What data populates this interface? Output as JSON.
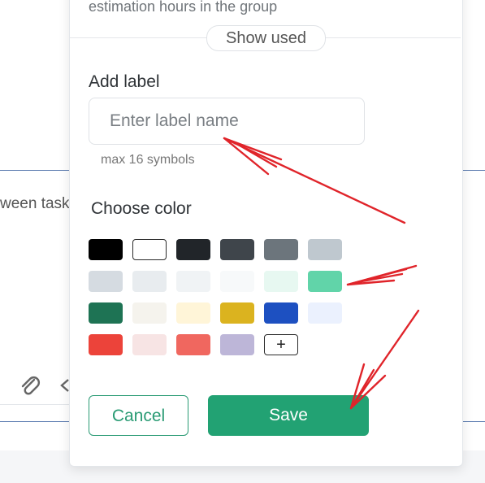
{
  "background": {
    "partial_text": "ween task"
  },
  "modal": {
    "top_hint": "estimation hours in the group",
    "show_used_label": "Show used",
    "add_label": {
      "title": "Add label",
      "input_placeholder": "Enter label name",
      "input_value": "",
      "hint": "max 16 symbols"
    },
    "choose_color": {
      "title": "Choose color",
      "add_custom_label": "+",
      "rows": [
        [
          "#000000",
          "#ffffff",
          "#212529",
          "#3f454b",
          "#6c757c",
          "#bfc8cf"
        ],
        [
          "#d5dbe1",
          "#e8ecef",
          "#f0f3f5",
          "#f7f9fa",
          "#e7f8f1",
          "#61d4a9"
        ],
        [
          "#1e7354",
          "#f5f3ed",
          "#fff5d8",
          "#dbb31f",
          "#1d50c1",
          "#ebf1fe"
        ],
        [
          "#ec433a",
          "#f7e4e4",
          "#f0675f",
          "#bdb6d8"
        ]
      ]
    },
    "buttons": {
      "cancel": "Cancel",
      "save": "Save"
    },
    "accent_color": "#22a273"
  }
}
